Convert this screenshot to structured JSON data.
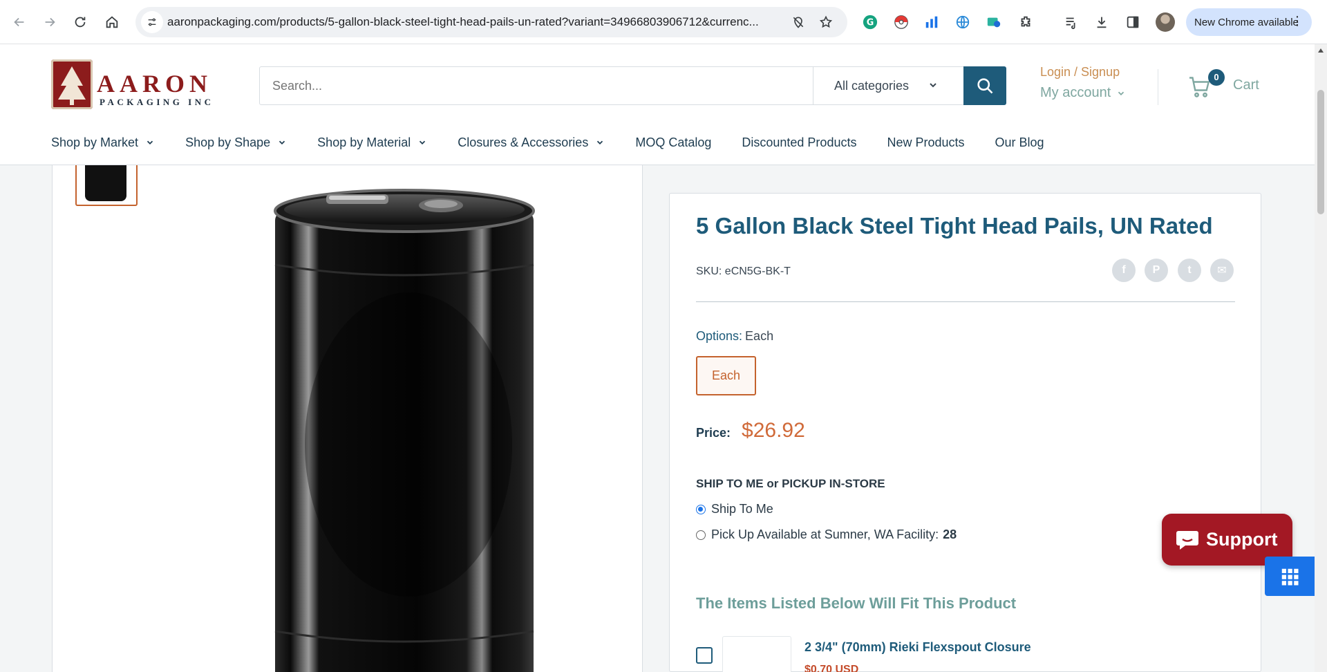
{
  "browser": {
    "url": "aaronpackaging.com/products/5-gallon-black-steel-tight-head-pails-un-rated?variant=34966803906712&currenc...",
    "update_label": "New Chrome available"
  },
  "header": {
    "logo_word": "AARON",
    "logo_sub": "PACKAGING INC",
    "search_placeholder": "Search...",
    "category": "All categories",
    "login": "Login / Signup",
    "account": "My account",
    "cart_count": "0",
    "cart_label": "Cart"
  },
  "nav": {
    "items": [
      {
        "label": "Shop by Market",
        "dropdown": true
      },
      {
        "label": "Shop by Shape",
        "dropdown": true
      },
      {
        "label": "Shop by Material",
        "dropdown": true
      },
      {
        "label": "Closures & Accessories",
        "dropdown": true
      },
      {
        "label": "MOQ Catalog",
        "dropdown": false
      },
      {
        "label": "Discounted Products",
        "dropdown": false
      },
      {
        "label": "New Products",
        "dropdown": false
      },
      {
        "label": "Our Blog",
        "dropdown": false
      }
    ]
  },
  "product": {
    "title": "5 Gallon Black Steel Tight Head Pails, UN Rated",
    "sku": "SKU: eCN5G-BK-T",
    "options_label": "Options:",
    "options_value": "Each",
    "option_button": "Each",
    "price_label": "Price:",
    "price": "$26.92",
    "ship_heading": "SHIP TO ME or PICKUP IN-STORE",
    "ship_option": "Ship To Me",
    "pickup_option": "Pick Up Available at Sumner, WA Facility:",
    "pickup_count": "28",
    "fits_heading": "The Items Listed Below Will Fit This Product",
    "fit_item_name": "2 3/4\" (70mm) Rieki Flexspout Closure",
    "fit_item_price": "$0.70 USD"
  },
  "share": [
    "f",
    "P",
    "t",
    "✉"
  ],
  "support_label": "Support",
  "colors": {
    "brand_blue": "#1e5b7a",
    "brand_red": "#8c1c1c",
    "accent_orange": "#d06a39",
    "support_red": "#a31824"
  }
}
